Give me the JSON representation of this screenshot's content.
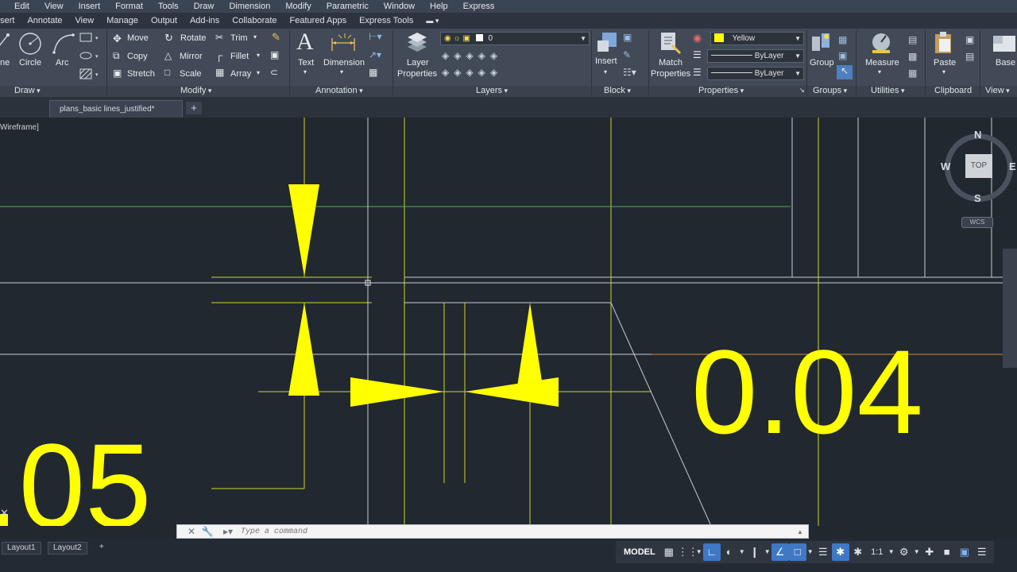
{
  "menubar": {
    "items": [
      "Edit",
      "View",
      "Insert",
      "Format",
      "Tools",
      "Draw",
      "Dimension",
      "Modify",
      "Parametric",
      "Window",
      "Help",
      "Express"
    ]
  },
  "ribbon_tabs": {
    "items": [
      "nsert",
      "Annotate",
      "View",
      "Manage",
      "Output",
      "Add-ins",
      "Collaborate",
      "Featured Apps",
      "Express Tools"
    ]
  },
  "ribbon": {
    "draw": {
      "title": "Draw",
      "line": "ne",
      "circle": "Circle",
      "arc": "Arc"
    },
    "modify": {
      "title": "Modify",
      "move": "Move",
      "rotate": "Rotate",
      "trim": "Trim",
      "copy": "Copy",
      "mirror": "Mirror",
      "fillet": "Fillet",
      "stretch": "Stretch",
      "scale": "Scale",
      "array": "Array"
    },
    "annotation": {
      "title": "Annotation",
      "text": "Text",
      "dimension": "Dimension"
    },
    "layers": {
      "title": "Layers",
      "layer_properties_1": "Layer",
      "layer_properties_2": "Properties",
      "current_layer": "0"
    },
    "block": {
      "title": "Block",
      "insert": "Insert"
    },
    "properties": {
      "title": "Properties",
      "match_1": "Match",
      "match_2": "Properties",
      "color": "Yellow",
      "linetype": "ByLayer",
      "lineweight": "ByLayer"
    },
    "groups": {
      "title": "Groups",
      "group": "Group"
    },
    "utilities": {
      "title": "Utilities",
      "measure": "Measure"
    },
    "clipboard": {
      "title": "Clipboard",
      "paste": "Paste"
    },
    "view": {
      "title": "View",
      "base": "Base"
    }
  },
  "file_tab": {
    "name": "plans_basic lines_justified*",
    "plus": "+"
  },
  "viewport": {
    "label": "Wireframe]"
  },
  "dimensions": {
    "right_text": "0.04",
    "left_text": ".05"
  },
  "viewcube": {
    "n": "N",
    "s": "S",
    "e": "E",
    "w": "W",
    "top": "TOP",
    "wcs": "WCS"
  },
  "commandline": {
    "placeholder": "Type a command"
  },
  "status": {
    "layout1": "Layout1",
    "layout2": "Layout2",
    "plus": "+",
    "model": "MODEL",
    "scale": "1:1"
  },
  "colors": {
    "accent_yellow": "#ffff00",
    "canvas_bg": "#212830",
    "ribbon_bg": "#414a56"
  }
}
